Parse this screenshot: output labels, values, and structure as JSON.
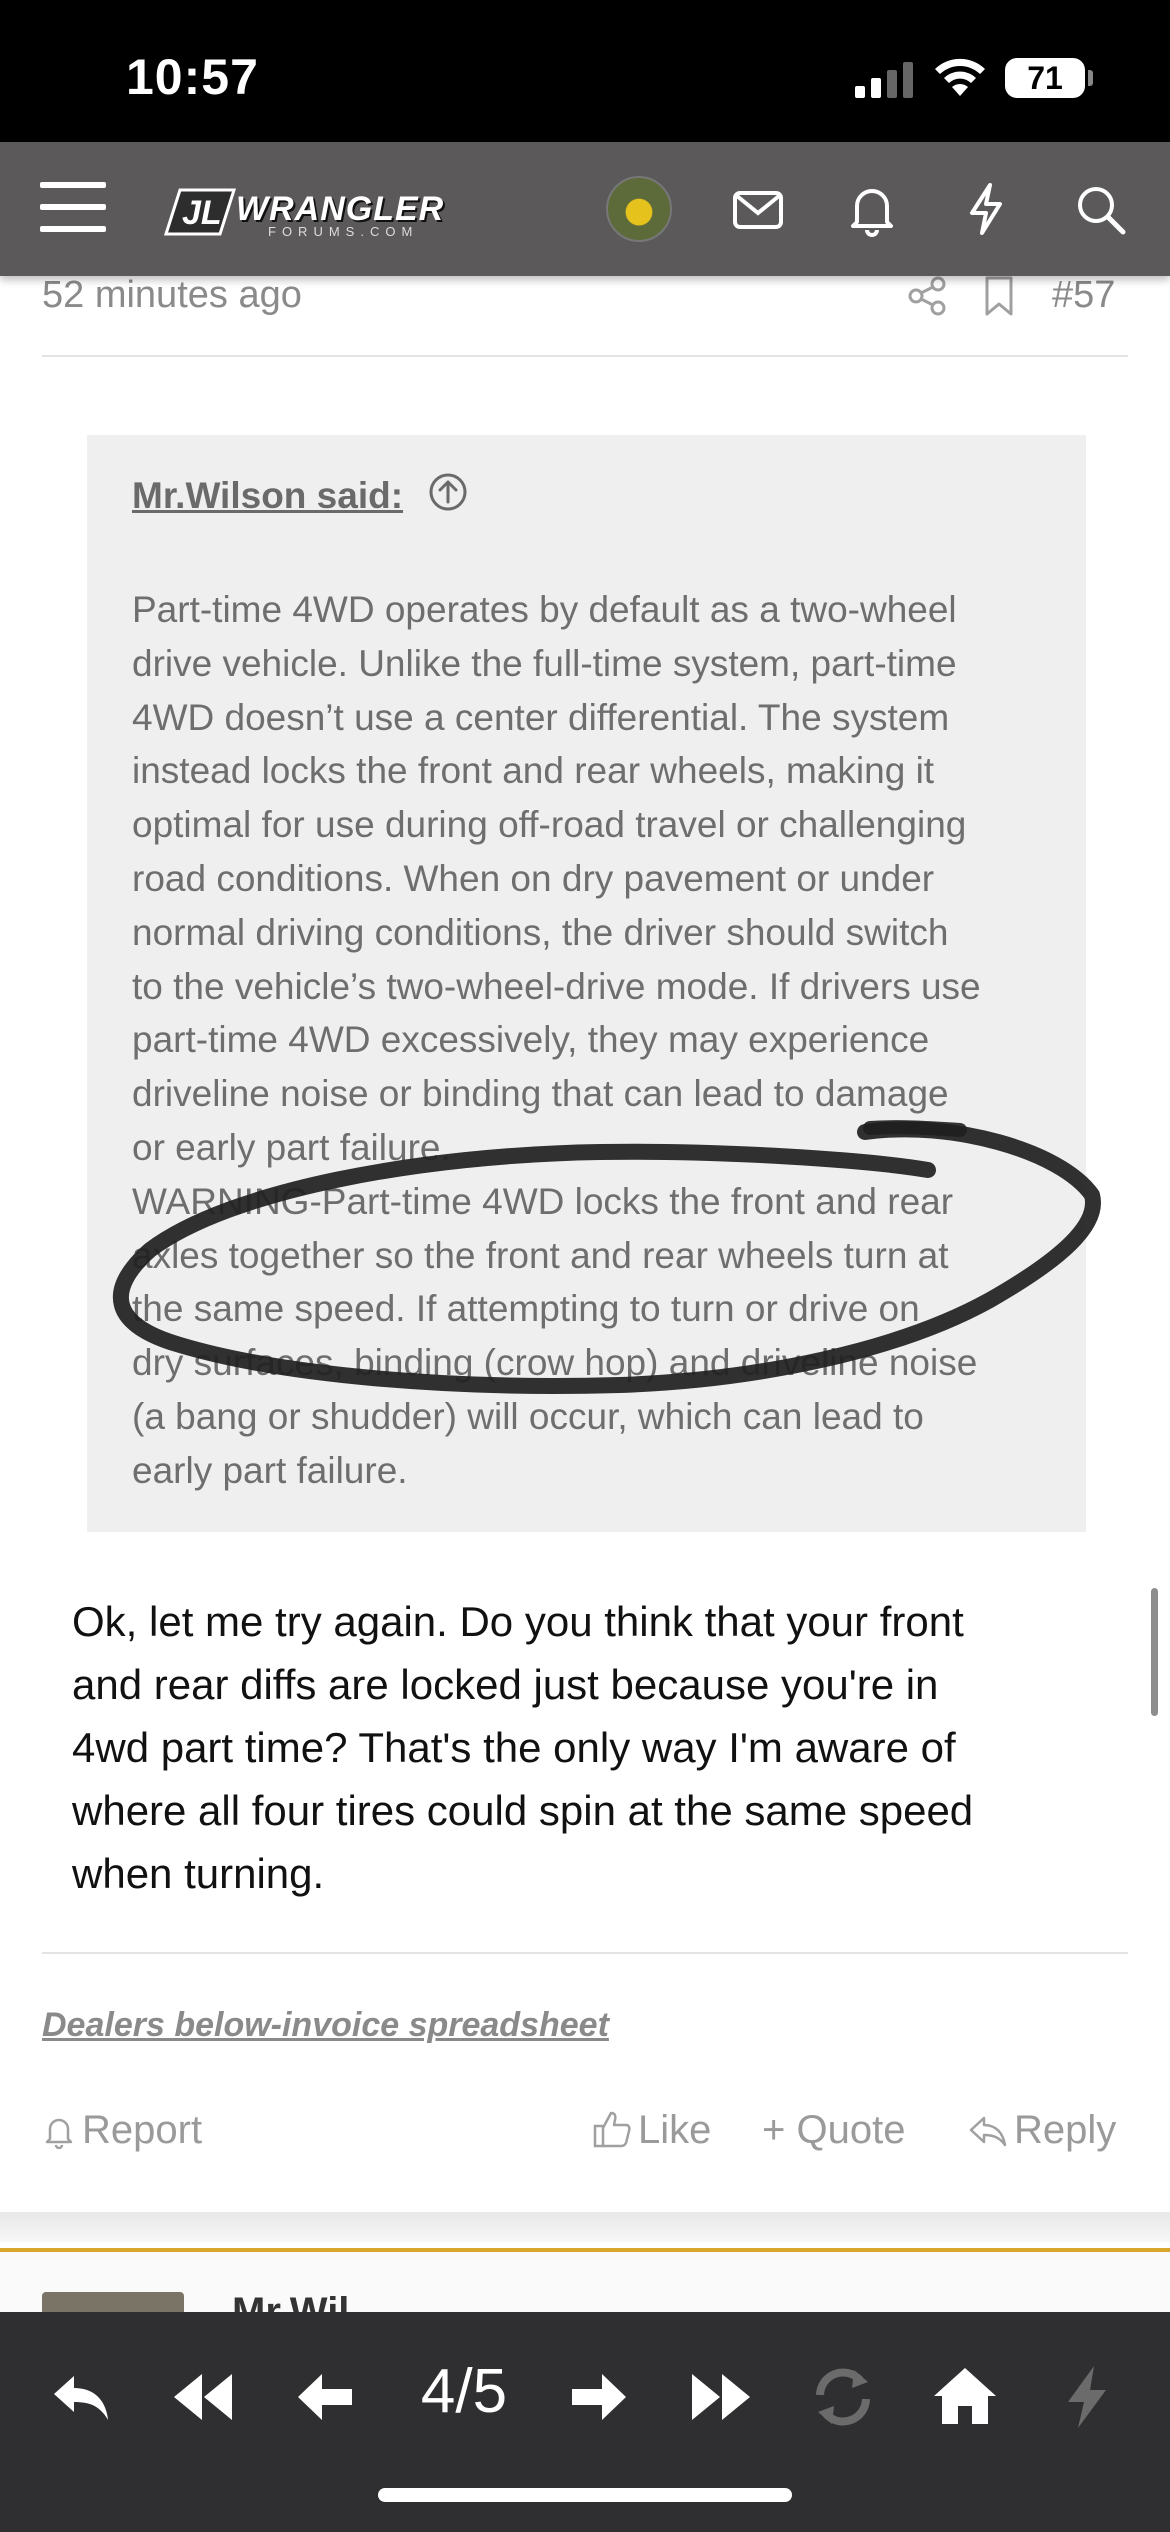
{
  "status_bar": {
    "time": "10:57",
    "battery": "71"
  },
  "header": {
    "logo_text": "WRANGLER",
    "logo_subtext": "FORUMS.COM",
    "logo_badge": "JL",
    "icons": [
      "menu-icon",
      "avatar",
      "mail-icon",
      "bell-icon",
      "lightning-icon",
      "search-icon"
    ]
  },
  "post": {
    "time": "52 minutes ago",
    "number": "#57",
    "quote": {
      "author": "Mr.Wilson said:",
      "paragraph_1": "Part-time 4WD operates by default as a two-wheel\ndrive vehicle. Unlike the full-time system, part-time\n4WD doesn’t use a center differential. The system\ninstead locks the front and rear wheels, making it\noptimal for use during off-road travel or challenging\nroad conditions. When on dry pavement or under\nnormal driving conditions, the driver should switch\nto the vehicle’s two-wheel-drive mode. If drivers use\npart-time 4WD excessively, they may experience\ndriveline noise or binding that can lead to damage\nor early part failure.",
      "paragraph_2": "WARNING-Part-time 4WD locks the front and rear\naxles together so the front and rear wheels turn at\nthe same speed. If attempting to turn or drive on\ndry surfaces, binding (crow hop) and driveline noise\n(a bang or shudder) will occur, which can lead to\nearly part failure."
    },
    "body": "Ok, let me try again. Do you think that your front\nand rear diffs are locked just because you're in\n4wd part time? That's the only way I'm aware of\nwhere all four tires could spin at the same speed\nwhen turning.",
    "signature_link": "Dealers below-invoice spreadsheet",
    "actions": {
      "report": "Report",
      "like": "Like",
      "quote": "+ Quote",
      "reply": "Reply"
    }
  },
  "next_post": {
    "author_partial": "Mr.Wil"
  },
  "toolbar": {
    "page_indicator": "4/5"
  },
  "colors": {
    "header_bg": "#5b5959",
    "toolbar_bg": "#2f2f31",
    "accent_gold": "#d8a62c",
    "quote_bg": "#efefef"
  }
}
